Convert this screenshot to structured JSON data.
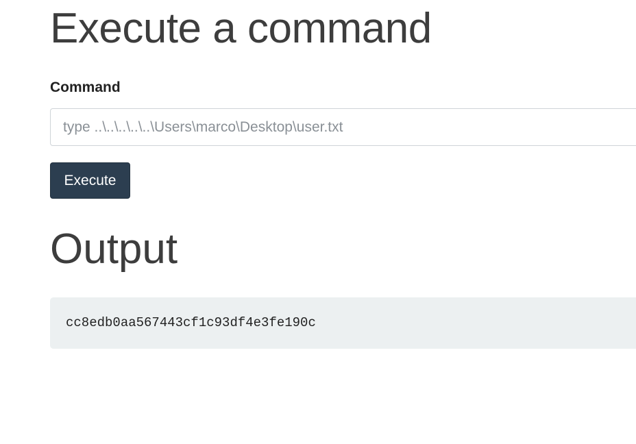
{
  "page": {
    "title": "Execute a command"
  },
  "form": {
    "label": "Command",
    "input": {
      "value": "",
      "placeholder": "type ..\\..\\..\\..\\..\\Users\\marco\\Desktop\\user.txt"
    },
    "button_label": "Execute"
  },
  "output": {
    "heading": "Output",
    "text": "cc8edb0aa567443cf1c93df4e3fe190c"
  },
  "colors": {
    "button_bg": "#2c3e50",
    "output_bg": "#ecf0f1"
  }
}
